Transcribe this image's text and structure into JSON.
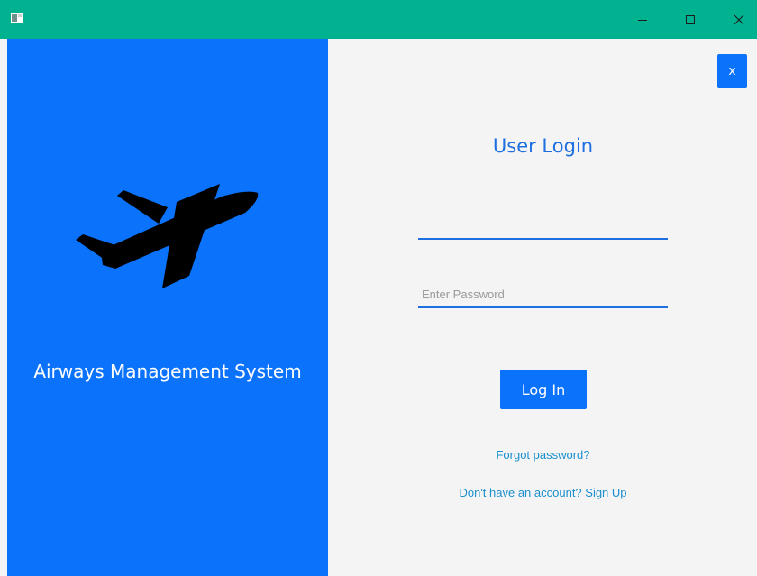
{
  "window": {
    "icon": "app-window-icon",
    "controls": [
      "minimize-icon",
      "maximize-icon",
      "close-icon"
    ],
    "titlebar_color": "#00b28f"
  },
  "left_panel": {
    "icon": "airplane-icon",
    "app_name": "Airways Management System",
    "bg_color": "#0b72fb"
  },
  "right_panel": {
    "close_label": "x",
    "title": "User Login",
    "username": {
      "value": "",
      "placeholder": ""
    },
    "password": {
      "value": "",
      "placeholder": "Enter Password"
    },
    "login_label": "Log In",
    "forgot_label": "Forgot password?",
    "signup_label": "Don't have an account? Sign Up",
    "accent_color": "#1e6fe0",
    "link_color": "#1a8fcf"
  }
}
